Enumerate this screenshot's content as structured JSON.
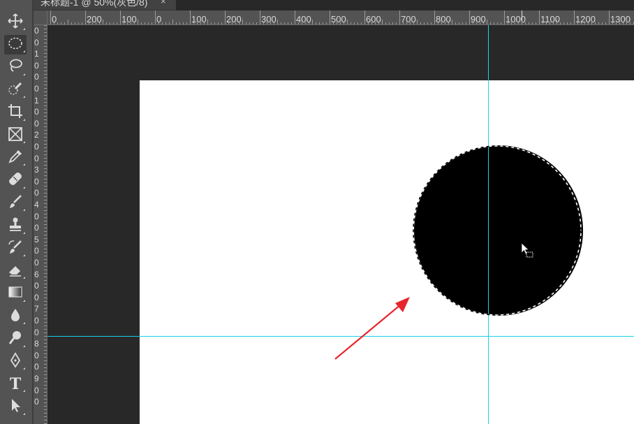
{
  "tab": {
    "title": "未标题-1 @ 50%(灰色/8)",
    "close_glyph": "×"
  },
  "toolbar": {
    "tools": [
      {
        "name": "move-tool",
        "icon": "move-icon",
        "active": false
      },
      {
        "name": "elliptical-marquee-tool",
        "icon": "elliptical-marquee-icon",
        "active": true
      },
      {
        "name": "lasso-tool",
        "icon": "lasso-icon",
        "active": false
      },
      {
        "name": "quick-selection-tool",
        "icon": "quick-selection-icon",
        "active": false
      },
      {
        "name": "crop-tool",
        "icon": "crop-icon",
        "active": false
      },
      {
        "name": "frame-tool",
        "icon": "frame-icon",
        "active": false
      },
      {
        "name": "eyedropper-tool",
        "icon": "eyedropper-icon",
        "active": false
      },
      {
        "name": "healing-brush-tool",
        "icon": "bandage-icon",
        "active": false
      },
      {
        "name": "brush-tool",
        "icon": "brush-icon",
        "active": false
      },
      {
        "name": "clone-stamp-tool",
        "icon": "stamp-icon",
        "active": false
      },
      {
        "name": "history-brush-tool",
        "icon": "history-brush-icon",
        "active": false
      },
      {
        "name": "eraser-tool",
        "icon": "eraser-icon",
        "active": false
      },
      {
        "name": "gradient-tool",
        "icon": "gradient-icon",
        "active": false
      },
      {
        "name": "blur-tool",
        "icon": "drop-icon",
        "active": false
      },
      {
        "name": "dodge-tool",
        "icon": "dodge-icon",
        "active": false
      },
      {
        "name": "pen-tool",
        "icon": "pen-icon",
        "active": false
      },
      {
        "name": "type-tool",
        "icon": "type-icon",
        "active": false,
        "glyph": "T"
      },
      {
        "name": "path-selection-tool",
        "icon": "path-selection-arrow-icon",
        "active": false
      }
    ]
  },
  "rulers": {
    "horizontal_labels": [
      "0",
      "200",
      "100",
      "0",
      "100",
      "200",
      "300",
      "400",
      "500",
      "600",
      "700",
      "800",
      "900",
      "1000",
      "1100",
      "1200",
      "1300"
    ],
    "vertical_labels": [
      "0",
      "0",
      "1",
      "0",
      "0",
      "0",
      "1",
      "0",
      "0",
      "2",
      "0",
      "0",
      "3",
      "0",
      "0",
      "4",
      "0",
      "0",
      "5",
      "0",
      "0",
      "6",
      "0",
      "0",
      "7",
      "0",
      "0",
      "8",
      "0",
      "0",
      "9",
      "0",
      "0"
    ]
  },
  "colors": {
    "workspace": "#282828",
    "panel": "#535353",
    "document": "#ffffff",
    "guide": "#19d3e8",
    "shape": "#000000",
    "annotation_arrow": "#e8252b"
  },
  "canvas": {
    "zoom_percent": 50,
    "shape": "black-circle",
    "selection": "elliptical-marching-ants"
  }
}
